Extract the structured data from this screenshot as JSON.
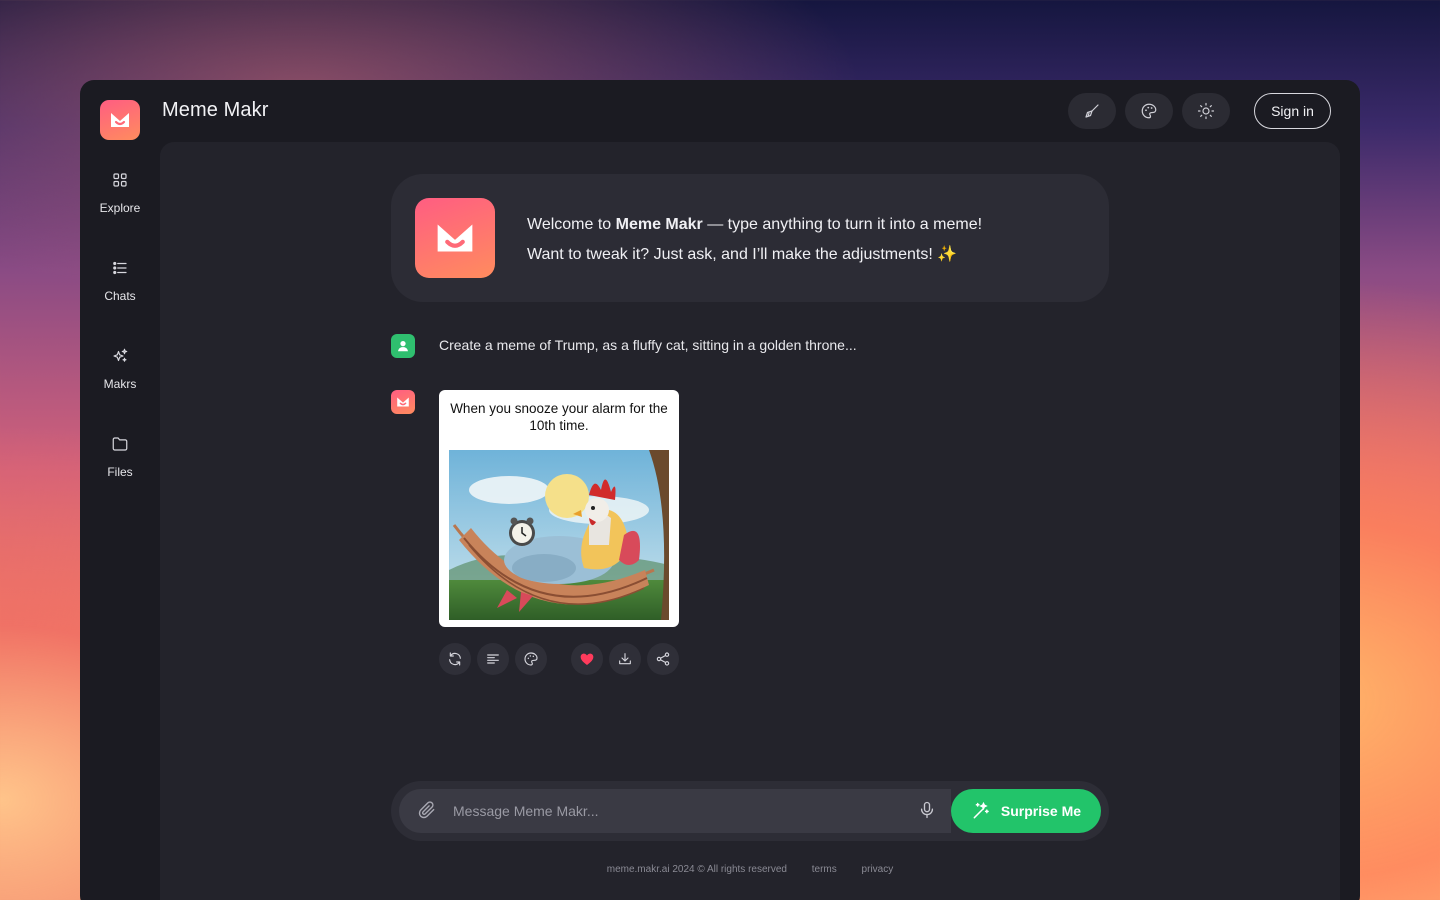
{
  "app": {
    "title": "Meme Makr"
  },
  "header": {
    "sign_in_label": "Sign in"
  },
  "sidebar": {
    "items": [
      {
        "label": "Explore",
        "icon": "grid-icon"
      },
      {
        "label": "Chats",
        "icon": "list-icon"
      },
      {
        "label": "Makrs",
        "icon": "sparkles-icon"
      },
      {
        "label": "Files",
        "icon": "folder-icon"
      }
    ]
  },
  "welcome": {
    "line1_prefix": "Welcome to ",
    "line1_brand": "Meme Makr",
    "line1_suffix": " — type anything to turn it into a meme!",
    "line2": "Want to tweak it? Just ask, and I’ll make the adjustments! ✨"
  },
  "conversation": {
    "user_message": "Create a meme of Trump, as a fluffy cat, sitting in a golden throne...",
    "meme_caption": "When you snooze your alarm for the 10th time."
  },
  "composer": {
    "placeholder": "Message Meme Makr...",
    "surprise_label": "Surprise Me"
  },
  "footer": {
    "copyright": "meme.makr.ai 2024 © All rights reserved",
    "terms": "terms",
    "privacy": "privacy"
  },
  "colors": {
    "accent_green": "#22c46a",
    "brand_gradient_start": "#ff5d82",
    "brand_gradient_end": "#ff8c5e",
    "heart_red": "#ff3b5c"
  }
}
